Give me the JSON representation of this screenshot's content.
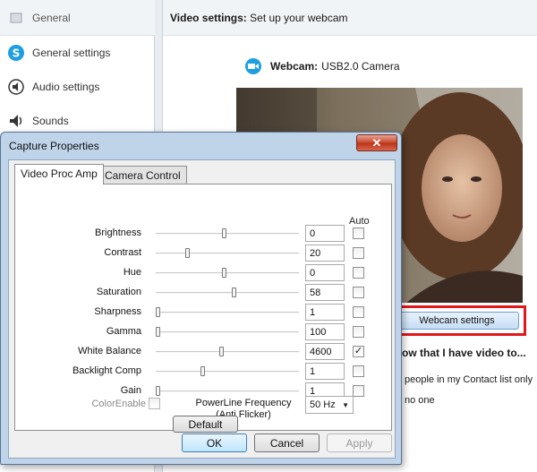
{
  "sidebar": {
    "header": "General",
    "items": [
      {
        "label": "General settings",
        "icon": "skype-icon"
      },
      {
        "label": "Audio settings",
        "icon": "audio-icon"
      },
      {
        "label": "Sounds",
        "icon": "speaker-icon"
      }
    ]
  },
  "main": {
    "header_title": "Video settings:",
    "header_sub": "Set up your webcam",
    "webcam_label": "Webcam:",
    "webcam_name": "USB2.0 Camera",
    "webcam_settings_button": "Webcam settings",
    "privacy_question": "ow that I have video to...",
    "privacy_options": [
      "people in my Contact list only",
      "no one"
    ]
  },
  "dialog": {
    "title": "Capture Properties",
    "close_glyph": "✕",
    "tabs": [
      "Video Proc Amp",
      "Camera Control"
    ],
    "auto_header": "Auto",
    "rows": [
      {
        "label": "Brightness",
        "value": "0",
        "level": 0.48,
        "auto": false
      },
      {
        "label": "Contrast",
        "value": "20",
        "level": 0.21,
        "auto": false
      },
      {
        "label": "Hue",
        "value": "0",
        "level": 0.48,
        "auto": false
      },
      {
        "label": "Saturation",
        "value": "58",
        "level": 0.55,
        "auto": false
      },
      {
        "label": "Sharpness",
        "value": "1",
        "level": 0.0,
        "auto": false
      },
      {
        "label": "Gamma",
        "value": "100",
        "level": 0.0,
        "auto": false
      },
      {
        "label": "White Balance",
        "value": "4600",
        "level": 0.46,
        "auto": true
      },
      {
        "label": "Backlight Comp",
        "value": "1",
        "level": 0.32,
        "auto": false
      },
      {
        "label": "Gain",
        "value": "1",
        "level": 0.0,
        "auto": false
      }
    ],
    "color_enable_label": "ColorEnable",
    "powerline_label_1": "PowerLine Frequency",
    "powerline_label_2": "(Anti Flicker)",
    "powerline_value": "50 Hz",
    "default_button": "Default",
    "ok_button": "OK",
    "cancel_button": "Cancel",
    "apply_button": "Apply"
  },
  "colors": {
    "accent_red": "#e0181b",
    "skype_blue": "#1f9ee0",
    "dialog_frame": "#bfd3e9"
  }
}
